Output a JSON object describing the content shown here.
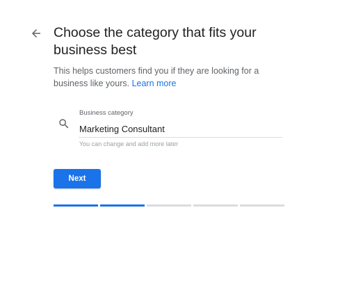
{
  "header": {
    "title": "Choose the category that fits your business best",
    "subtitle_text": "This helps customers find you if they are looking for a business like yours.",
    "learn_more": "Learn more"
  },
  "icons": {
    "back": "arrow-back-icon",
    "search": "search-icon"
  },
  "category_field": {
    "label": "Business category",
    "value": "Marketing Consultant",
    "hint": "You can change and add more later"
  },
  "actions": {
    "next_label": "Next"
  },
  "progress": {
    "total_steps": 5,
    "completed_steps": 2
  },
  "colors": {
    "accent": "#1a73e8",
    "progress_inactive": "#dadce0"
  }
}
